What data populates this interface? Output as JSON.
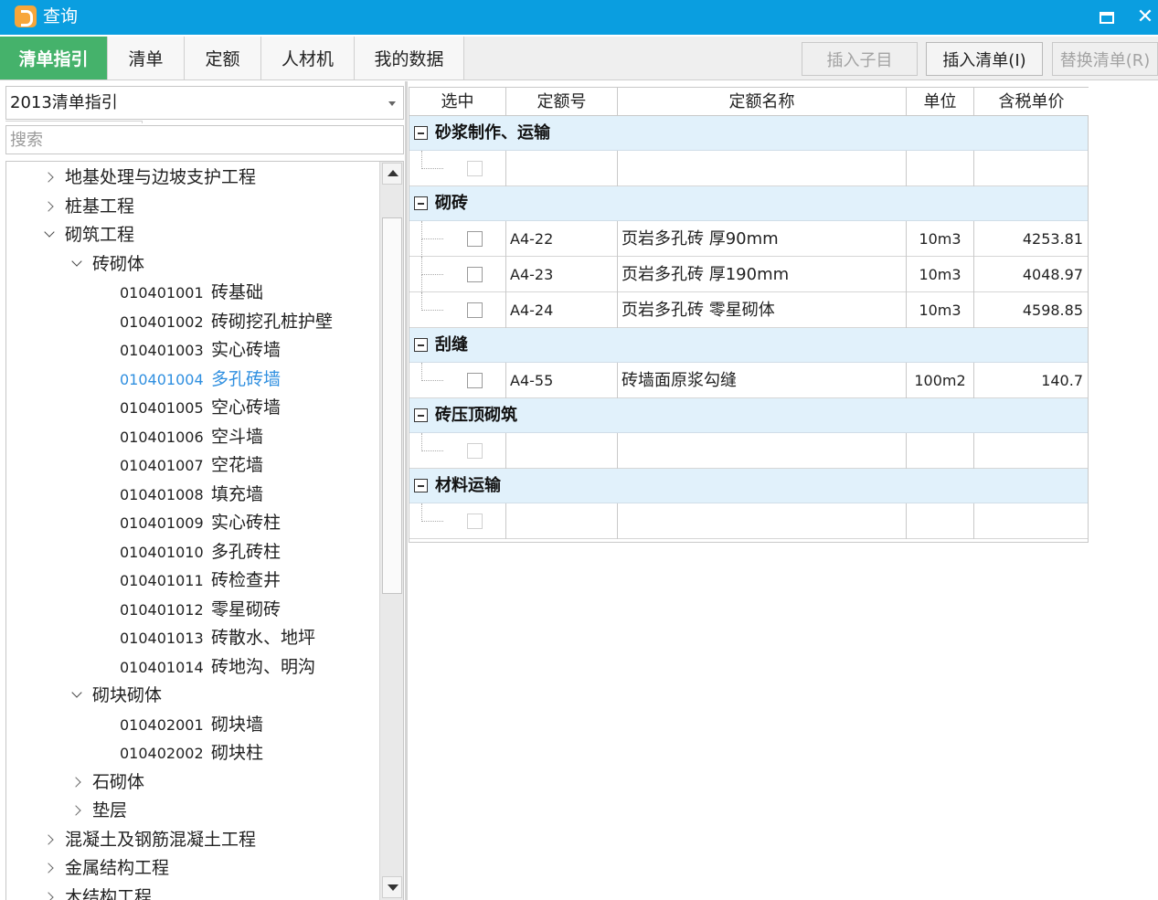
{
  "window": {
    "title": "查询"
  },
  "tabs": [
    {
      "label": "清单指引",
      "active": true
    },
    {
      "label": "清单",
      "active": false
    },
    {
      "label": "定额",
      "active": false
    },
    {
      "label": "人材机",
      "active": false
    },
    {
      "label": "我的数据",
      "active": false
    }
  ],
  "toolbar": {
    "insert_child": "插入子目",
    "insert_bill": "插入清单(I)",
    "replace_bill": "替换清单(R)"
  },
  "left": {
    "combo_value": "2013清单指引",
    "search_placeholder": "搜索",
    "tree": [
      {
        "level": 0,
        "state": "collapsed",
        "name": "地基处理与边坡支护工程"
      },
      {
        "level": 0,
        "state": "collapsed",
        "name": "桩基工程"
      },
      {
        "level": 0,
        "state": "expanded",
        "name": "砌筑工程"
      },
      {
        "level": 1,
        "state": "expanded",
        "name": "砖砌体"
      },
      {
        "level": 2,
        "code": "010401001",
        "name": "砖基础"
      },
      {
        "level": 2,
        "code": "010401002",
        "name": "砖砌挖孔桩护壁"
      },
      {
        "level": 2,
        "code": "010401003",
        "name": "实心砖墙"
      },
      {
        "level": 2,
        "code": "010401004",
        "name": "多孔砖墙",
        "selected": true
      },
      {
        "level": 2,
        "code": "010401005",
        "name": "空心砖墙"
      },
      {
        "level": 2,
        "code": "010401006",
        "name": "空斗墙"
      },
      {
        "level": 2,
        "code": "010401007",
        "name": "空花墙"
      },
      {
        "level": 2,
        "code": "010401008",
        "name": "填充墙"
      },
      {
        "level": 2,
        "code": "010401009",
        "name": "实心砖柱"
      },
      {
        "level": 2,
        "code": "010401010",
        "name": "多孔砖柱"
      },
      {
        "level": 2,
        "code": "010401011",
        "name": "砖检查井"
      },
      {
        "level": 2,
        "code": "010401012",
        "name": "零星砌砖"
      },
      {
        "level": 2,
        "code": "010401013",
        "name": "砖散水、地坪"
      },
      {
        "level": 2,
        "code": "010401014",
        "name": "砖地沟、明沟"
      },
      {
        "level": 1,
        "state": "expanded",
        "name": "砌块砌体"
      },
      {
        "level": 2,
        "code": "010402001",
        "name": "砌块墙"
      },
      {
        "level": 2,
        "code": "010402002",
        "name": "砌块柱"
      },
      {
        "level": 1,
        "state": "collapsed",
        "name": "石砌体"
      },
      {
        "level": 1,
        "state": "collapsed",
        "name": "垫层"
      },
      {
        "level": 0,
        "state": "collapsed",
        "name": "混凝土及钢筋混凝土工程"
      },
      {
        "level": 0,
        "state": "collapsed",
        "name": "金属结构工程"
      },
      {
        "level": 0,
        "state": "collapsed",
        "name": "木结构工程"
      }
    ]
  },
  "grid": {
    "headers": [
      "选中",
      "定额号",
      "定额名称",
      "单位",
      "含税单价"
    ],
    "groups": [
      {
        "title": "砂浆制作、运输",
        "rows": [
          {
            "code": "",
            "name": "",
            "unit": "",
            "price": "",
            "enabled": false
          }
        ]
      },
      {
        "title": "砌砖",
        "rows": [
          {
            "code": "A4-22",
            "name": "页岩多孔砖 厚90mm",
            "unit": "10m3",
            "price": "4253.81",
            "enabled": true
          },
          {
            "code": "A4-23",
            "name": "页岩多孔砖 厚190mm",
            "unit": "10m3",
            "price": "4048.97",
            "enabled": true
          },
          {
            "code": "A4-24",
            "name": "页岩多孔砖 零星砌体",
            "unit": "10m3",
            "price": "4598.85",
            "enabled": true
          }
        ]
      },
      {
        "title": "刮缝",
        "rows": [
          {
            "code": "A4-55",
            "name": "砖墙面原浆勾缝",
            "unit": "100m2",
            "price": "140.7",
            "enabled": true
          }
        ]
      },
      {
        "title": "砖压顶砌筑",
        "rows": [
          {
            "code": "",
            "name": "",
            "unit": "",
            "price": "",
            "enabled": false
          }
        ]
      },
      {
        "title": "材料运输",
        "rows": [
          {
            "code": "",
            "name": "",
            "unit": "",
            "price": "",
            "enabled": false
          }
        ]
      }
    ]
  }
}
